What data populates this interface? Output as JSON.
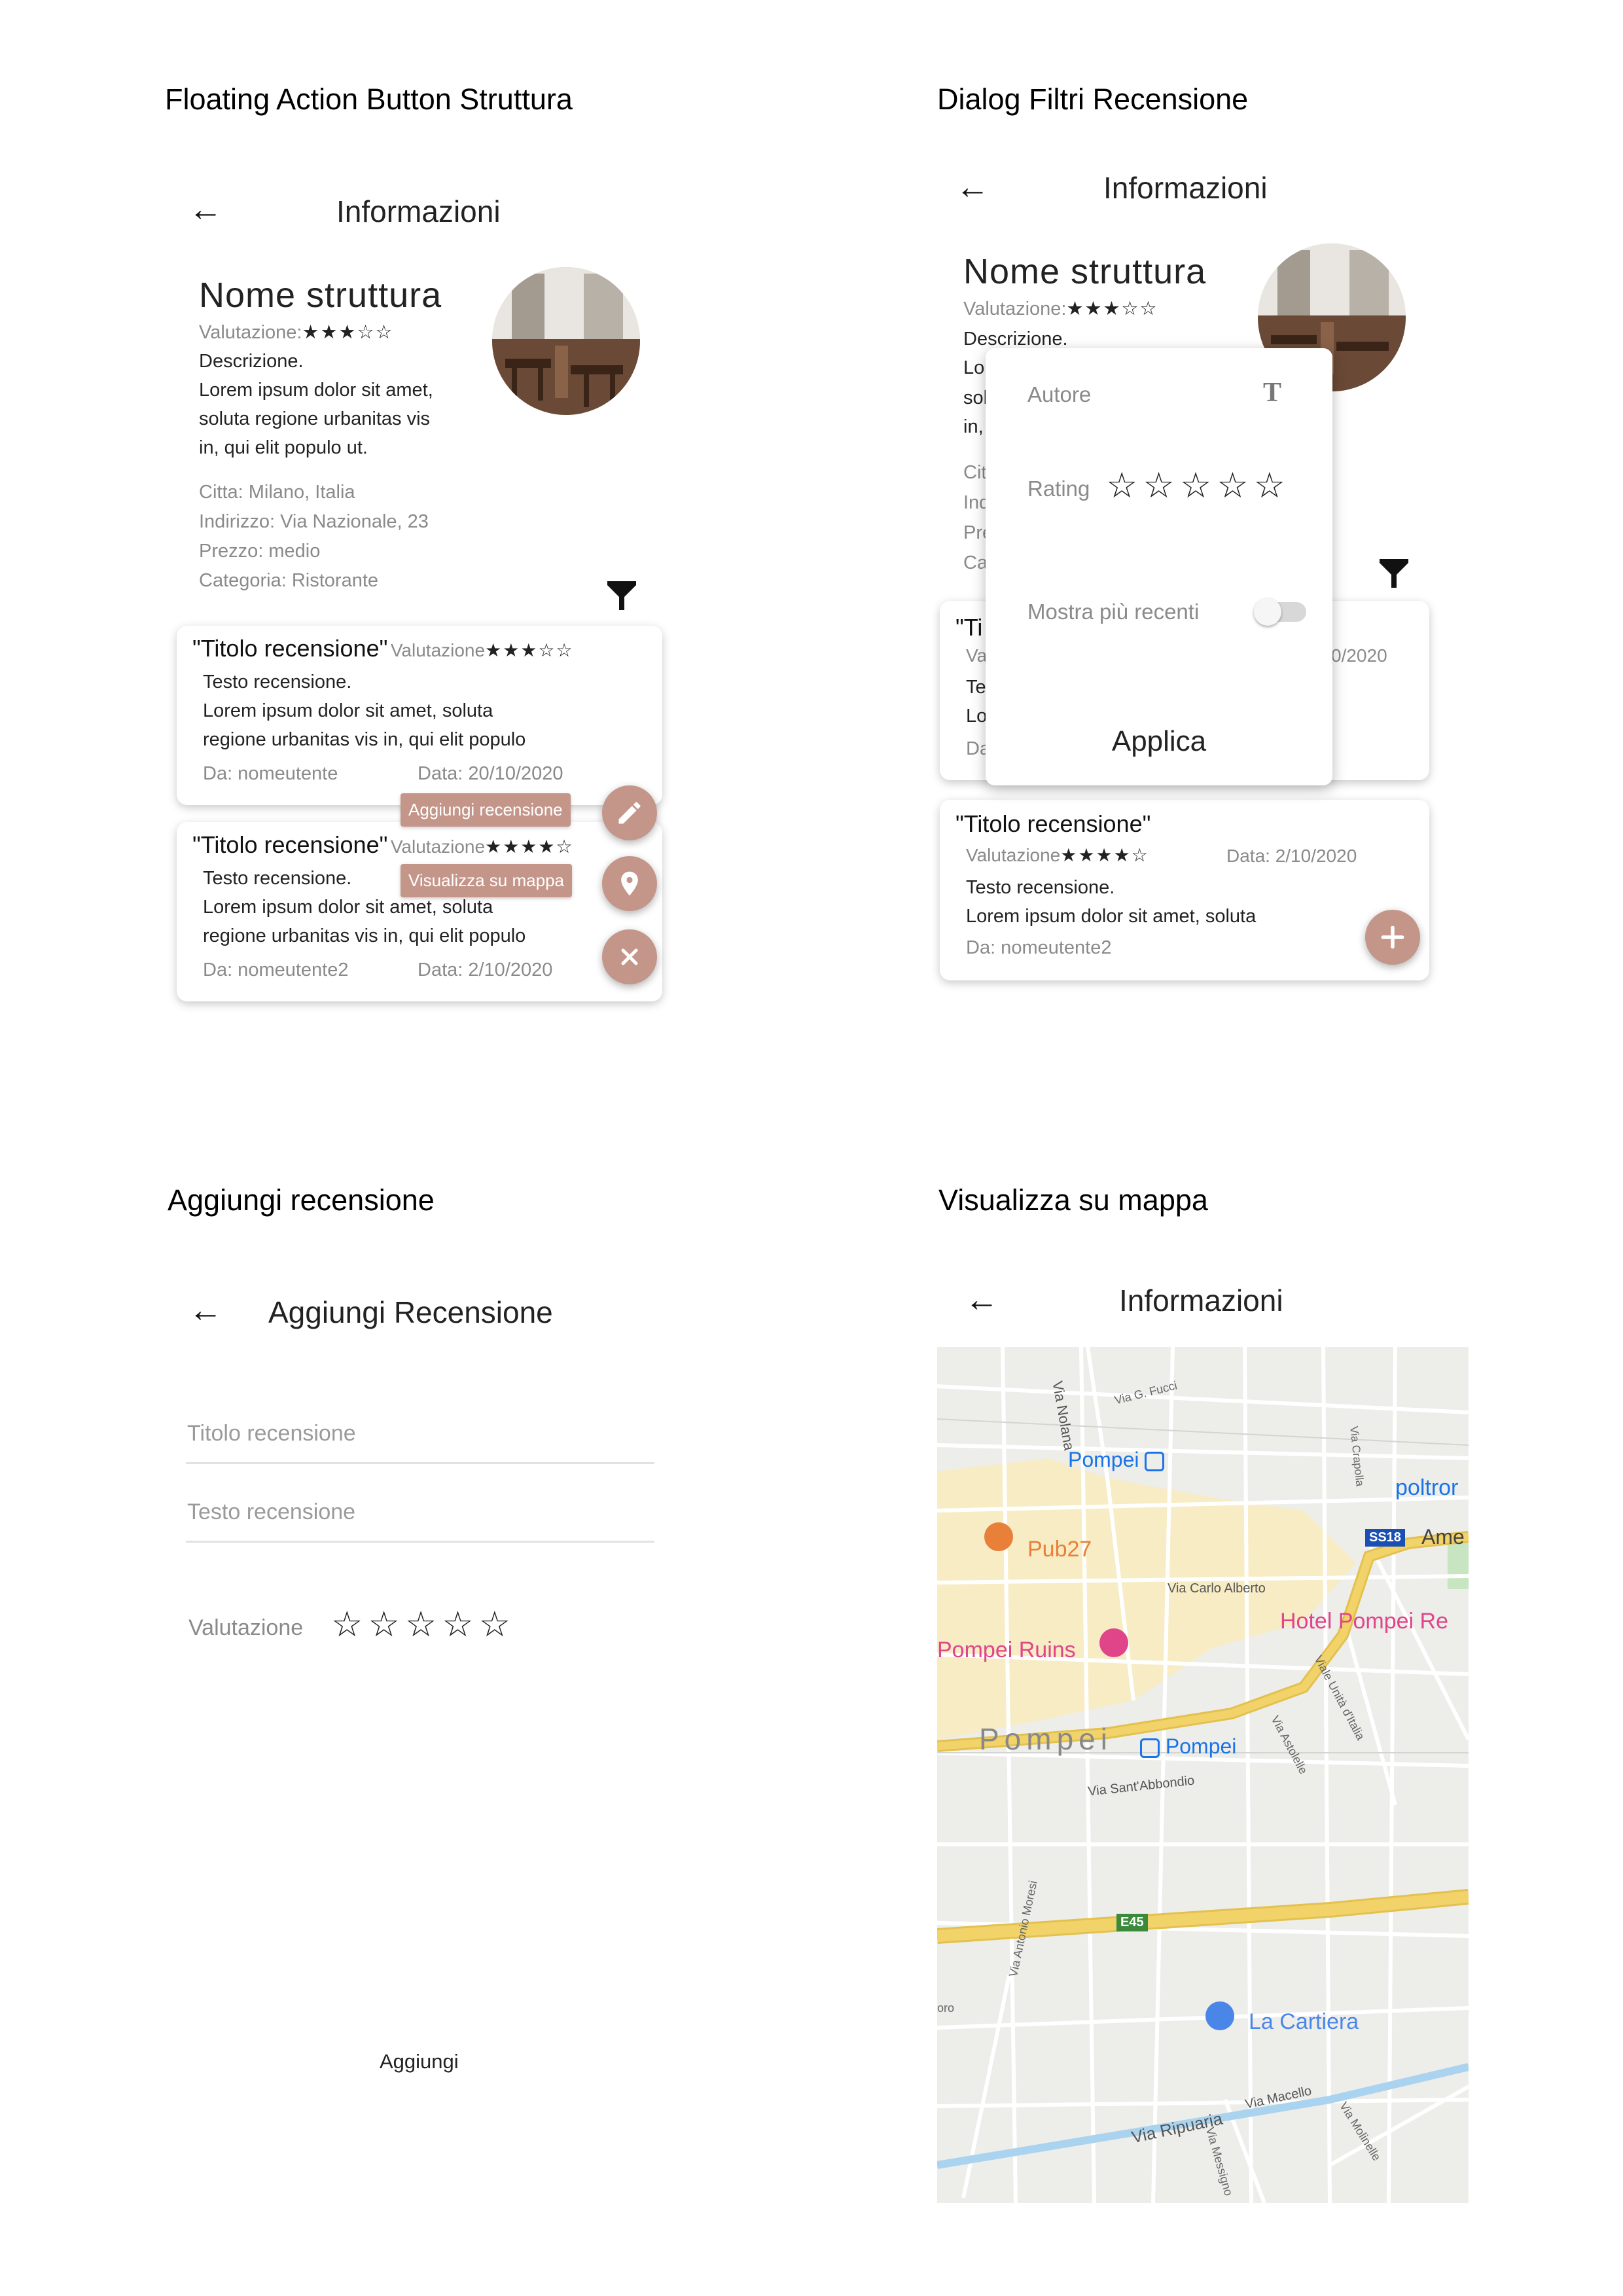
{
  "sections": {
    "fab": "Floating Action Button Struttura",
    "dialog": "Dialog Filtri Recensione",
    "add": "Aggiungi recensione",
    "map": "Visualizza su mappa"
  },
  "appbar": {
    "back_icon": "←",
    "title_info": "Informazioni",
    "title_add": "Aggiungi Recensione"
  },
  "struttura": {
    "nome": "Nome struttura",
    "valutazione_label": "Valutazione:",
    "valutazione_stars": "★★★☆☆",
    "rating": 3.5,
    "descrizione_label": "Descrizione.",
    "descrizione_lines": [
      "Lorem ipsum dolor sit amet,",
      "soluta regione urbanitas vis",
      "in, qui elit populo ut."
    ],
    "citta": "Citta: Milano, Italia",
    "indirizzo": "Indirizzo: Via Nazionale, 23",
    "prezzo": "Prezzo: medio",
    "categoria": "Categoria: Ristorante"
  },
  "reviews": [
    {
      "titolo": "\"Titolo recensione\"",
      "valutazione_label": "Valutazione",
      "stars": "★★★☆☆",
      "testo": "Testo recensione.",
      "lines": [
        "Lorem ipsum dolor sit amet, soluta",
        "regione urbanitas vis in, qui elit populo"
      ],
      "autore": "Da: nomeutente",
      "data": "Data: 20/10/2020"
    },
    {
      "titolo": "\"Titolo recensione\"",
      "valutazione_label": "Valutazione",
      "stars": "★★★★☆",
      "testo": "Testo recensione.",
      "lines": [
        "Lorem ipsum dolor sit amet, soluta",
        "regione urbanitas vis in, qui elit populo"
      ],
      "autore": "Da: nomeutente2",
      "data": "Data: 2/10/2020"
    }
  ],
  "fab_menu": {
    "aggiungi_label": "Aggiungi recensione",
    "mappa_label": "Visualizza su mappa",
    "icons": [
      "pencil-icon",
      "location-pin-icon",
      "close-icon"
    ],
    "color": "#c4968a"
  },
  "dialog": {
    "autore_label": "Autore",
    "autore_icon": "T",
    "rating_label": "Rating",
    "rating_stars": "☆☆☆☆☆",
    "recenti_label": "Mostra più recenti",
    "toggle_on": false,
    "apply_label": "Applica",
    "bg_fragments": [
      "Lo",
      "sol",
      "in,",
      "Cit",
      "Ind",
      "Pre",
      "Ca",
      "\"Ti",
      "Va",
      "Te",
      "Lo",
      "Da",
      "0/2020"
    ]
  },
  "dialog_card2": {
    "titolo": "\"Titolo recensione\"",
    "valutazione": "Valutazione",
    "stars": "★★★★☆",
    "data": "Data: 2/10/2020",
    "testo": "Testo recensione.",
    "line": "Lorem ipsum dolor sit amet, soluta",
    "autore": "Da: nomeutente2"
  },
  "add_form": {
    "titolo_placeholder": "Titolo recensione",
    "testo_placeholder": "Testo recensione",
    "valutazione_label": "Valutazione",
    "stars": "☆☆☆☆☆",
    "submit_label": "Aggiungi"
  },
  "map": {
    "labels": {
      "via_nolana": "Via Nolana",
      "via_fucci": "Via G. Fucci",
      "pompei_station_top": "Pompei",
      "via_crapolla": "Via Crapolla",
      "poltrona": "poltror",
      "ss18": "SS18",
      "ame": "Ame",
      "pub27": "Pub27",
      "via_carlo_alberto": "Via Carlo Alberto",
      "hotel": "Hotel Pompei Re",
      "ruins": "Pompei Ruins",
      "via_unita": "Viale Unità d'Italia",
      "pompei_city": "Pompei",
      "pompei_station_mid": "Pompei",
      "via_astolelle": "Via Astolelle",
      "via_sant": "Via Sant'Abbondio",
      "e45": "E45",
      "la_cartiera": "La Cartiera",
      "via_moresi": "Via Antonio Moresi",
      "via_macello": "Via Macello",
      "via_ripuaria": "Via Ripuaria",
      "via_messigno": "Via Messigno",
      "via_molinelle": "Via Molinelle",
      "oro": "oro"
    },
    "colors": {
      "bg": "#ededea",
      "road": "#ffffff",
      "highway": "#f2d36a",
      "urban": "#f7ecc4",
      "water": "#aad3f0",
      "transit": "#1a73e8",
      "food": "#e8803a",
      "attraction": "#e0458a",
      "shop": "#4a86e8"
    }
  }
}
